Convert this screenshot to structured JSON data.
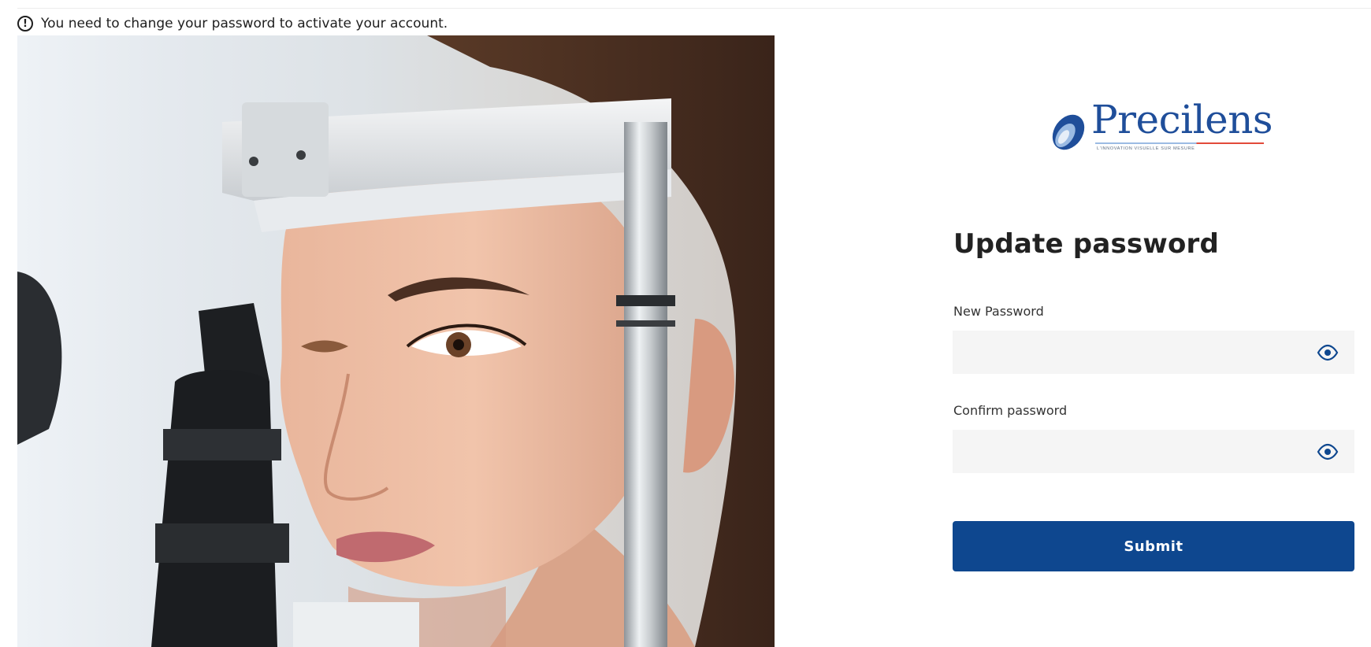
{
  "notice": {
    "icon": "alert-circle-icon",
    "text": "You need to change your password to activate your account."
  },
  "hero_image": {
    "subject": "eye-exam-photo"
  },
  "brand": {
    "name": "Precilens",
    "tagline": "L'innovation visuelle sur mesure",
    "color": "#1f4e9a",
    "accent": "#e24a3a"
  },
  "form": {
    "title": "Update password",
    "new_password": {
      "label": "New Password",
      "value": "",
      "icon": "eye-icon"
    },
    "confirm_password": {
      "label": "Confirm password",
      "value": "",
      "icon": "eye-icon"
    },
    "submit_label": "Submit",
    "submit_color": "#0e478f"
  }
}
